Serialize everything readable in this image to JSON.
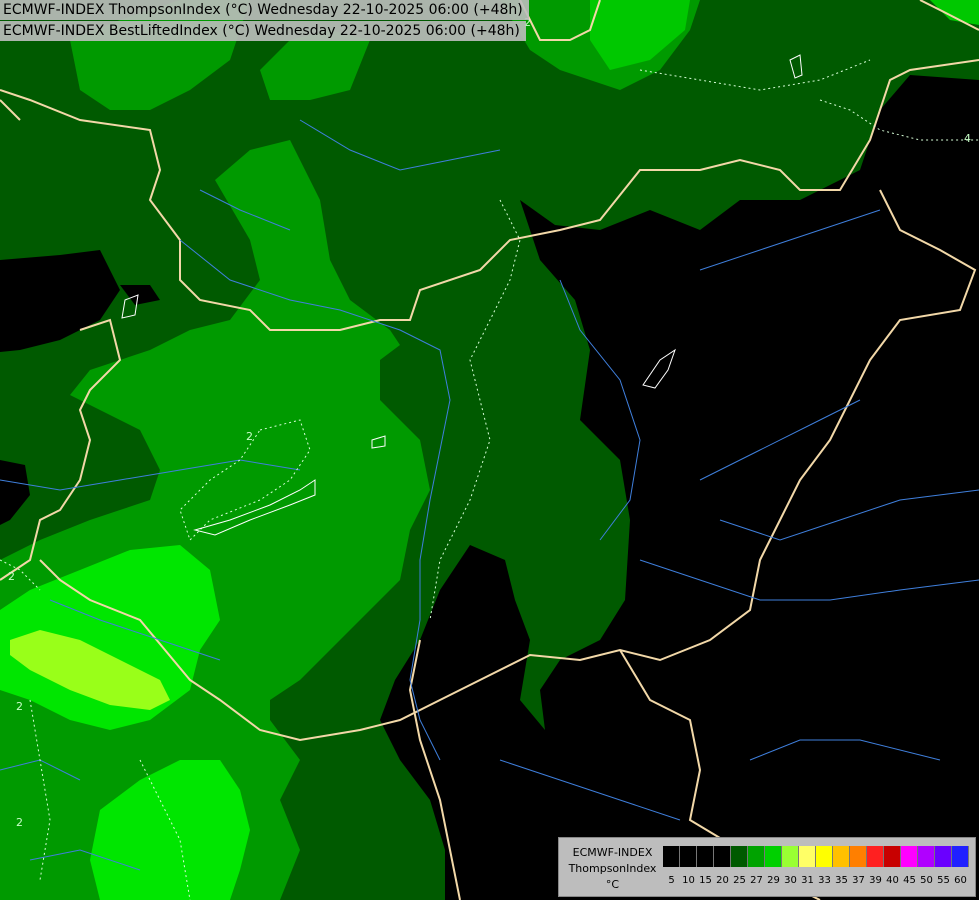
{
  "header": {
    "line1": "ECMWF-INDEX ThompsonIndex (°C) Wednesday 22-10-2025 06:00 (+48h)",
    "line2": "ECMWF-INDEX BestLiftedIndex (°C) Wednesday 22-10-2025 06:00 (+48h)"
  },
  "contour_labels": [
    "2",
    "2",
    "2",
    "2",
    "2",
    "4"
  ],
  "legend": {
    "title": "ECMWF-INDEX",
    "subtitle": "ThompsonIndex",
    "unit": "°C",
    "ticks": [
      "5",
      "10",
      "15",
      "20",
      "25",
      "27",
      "29",
      "30",
      "31",
      "33",
      "35",
      "37",
      "39",
      "40",
      "45",
      "50",
      "55",
      "60"
    ],
    "colors": [
      "#000000",
      "#000000",
      "#000000",
      "#000000",
      "#005a00",
      "#00a300",
      "#00d000",
      "#99ff33",
      "#ffff66",
      "#ffff00",
      "#ffc000",
      "#ff7f00",
      "#ff2020",
      "#c80000",
      "#ff00ff",
      "#b000ff",
      "#6a00ff",
      "#2020ff"
    ]
  },
  "palette": {
    "dark_green": "#005a00",
    "medium_green": "#009a00",
    "bright_green": "#00e600",
    "yellow_green": "#99ff19",
    "background": "#000000",
    "border": "#f2d8a8",
    "river": "#3f7fdc"
  }
}
